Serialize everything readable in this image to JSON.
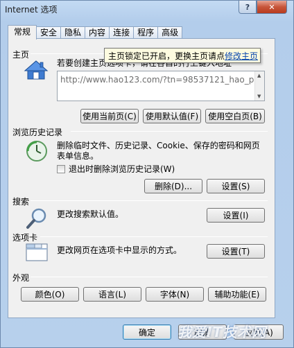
{
  "window": {
    "title": "Internet 选项",
    "help_label": "?",
    "close_label": "✕"
  },
  "tabs": [
    {
      "label": "常规",
      "active": true
    },
    {
      "label": "安全"
    },
    {
      "label": "隐私"
    },
    {
      "label": "内容"
    },
    {
      "label": "连接"
    },
    {
      "label": "程序"
    },
    {
      "label": "高级"
    }
  ],
  "homepage": {
    "label": "主页",
    "description": "若要创建主页选项卡，请在各自的行上键入地址",
    "url_value": "http://www.hao123.com/?tn=98537121_hao_pg",
    "btn_current": "使用当前页(C)",
    "btn_default": "使用默认值(F)",
    "btn_blank": "使用空白页(B)",
    "tooltip_text": "主页锁定已开启，更换主页请点",
    "tooltip_link": "修改主页"
  },
  "history": {
    "label": "浏览历史记录",
    "description_line1": "删除临时文件、历史记录、Cookie、保存的密码和网页",
    "description_line2": "表单信息。",
    "checkbox_label": "退出时删除浏览历史记录(W)",
    "btn_delete": "删除(D)...",
    "btn_settings": "设置(S)"
  },
  "search": {
    "label": "搜索",
    "description": "更改搜索默认值。",
    "btn_settings": "设置(I)"
  },
  "tabs_section": {
    "label": "选项卡",
    "description": "更改网页在选项卡中显示的方式。",
    "btn_settings": "设置(T)"
  },
  "appearance": {
    "label": "外观",
    "btn_colors": "颜色(O)",
    "btn_languages": "语言(L)",
    "btn_fonts": "字体(N)",
    "btn_accessibility": "辅助功能(E)"
  },
  "footer": {
    "btn_ok": "确定",
    "btn_cancel": "取消",
    "btn_apply": "应用(A)"
  },
  "watermark": "我爱IT技术网"
}
